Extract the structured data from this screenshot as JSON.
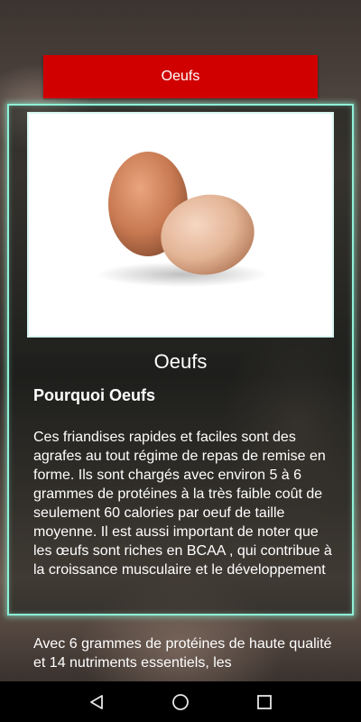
{
  "header": {
    "title_button": "Oeufs"
  },
  "card": {
    "image_icon": "egg-photo",
    "title": "Oeufs",
    "subtitle": "Pourquoi Oeufs",
    "paragraph1": "Ces friandises rapides et faciles sont des agrafes au tout régime de repas de remise en forme. Ils sont chargés avec environ 5 à 6 grammes de protéines à la très faible coût de seulement 60 calories par oeuf de taille moyenne. Il est aussi important de noter que les œufs sont riches en BCAA , qui contribue à la croissance musculaire et le développement",
    "paragraph2": "Avec 6 grammes de protéines de haute qualité et 14 nutriments essentiels, les"
  },
  "navbar": {
    "back_icon": "back-triangle-icon",
    "home_icon": "home-circle-icon",
    "recents_icon": "recents-square-icon"
  }
}
